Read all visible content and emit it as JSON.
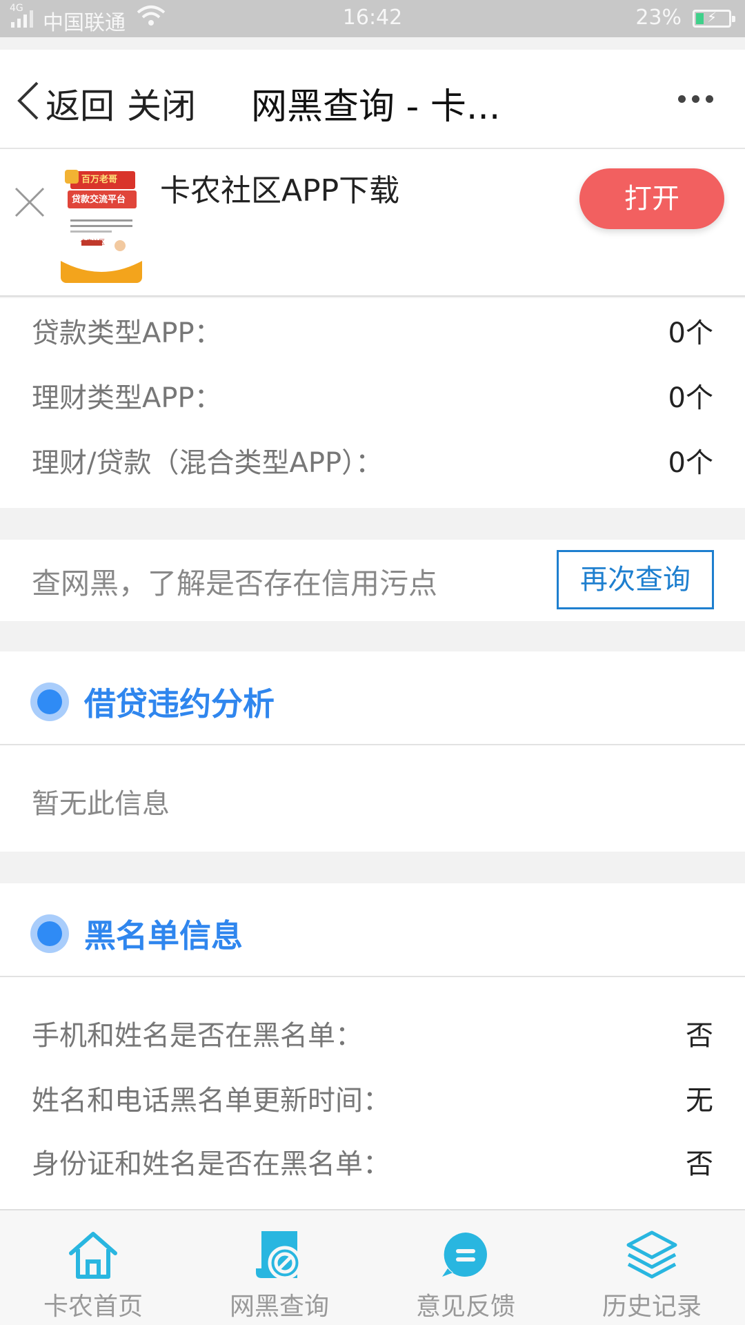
{
  "status_bar": {
    "network": "4G",
    "carrier": "中国联通",
    "time": "16:42",
    "battery": "23%",
    "battery_level": 0.23
  },
  "nav": {
    "back": "返回",
    "close": "关闭",
    "title": "网黑查询 - 卡..."
  },
  "banner": {
    "app_name": "卡农社区APP下载",
    "open": "打开",
    "thumb_title": "百万老哥",
    "thumb_subtitle": "贷款交流平台",
    "thumb_brand": "卡农社区"
  },
  "app_counts": [
    {
      "label": "贷款类型APP：",
      "value": "0个"
    },
    {
      "label": "理财类型APP：",
      "value": "0个"
    },
    {
      "label": "理财/贷款（混合类型APP）：",
      "value": "0个"
    }
  ],
  "query": {
    "prompt": "查网黑，了解是否存在信用污点",
    "again": "再次查询"
  },
  "default_analysis": {
    "title": "借贷违约分析",
    "empty": "暂无此信息"
  },
  "blacklist": {
    "title": "黑名单信息",
    "rows": [
      {
        "label": "手机和姓名是否在黑名单：",
        "value": "否"
      },
      {
        "label": "姓名和电话黑名单更新时间：",
        "value": "无"
      },
      {
        "label": "身份证和姓名是否在黑名单：",
        "value": "否"
      }
    ]
  },
  "tabs": [
    {
      "label": "卡农首页",
      "icon": "home-icon"
    },
    {
      "label": "网黑查询",
      "icon": "search-blacklist-icon"
    },
    {
      "label": "意见反馈",
      "icon": "feedback-icon"
    },
    {
      "label": "历史记录",
      "icon": "layers-icon"
    }
  ],
  "colors": {
    "accent_blue": "#2f86ee",
    "tab_icon": "#29b6e0",
    "open_button": "#f26060"
  }
}
